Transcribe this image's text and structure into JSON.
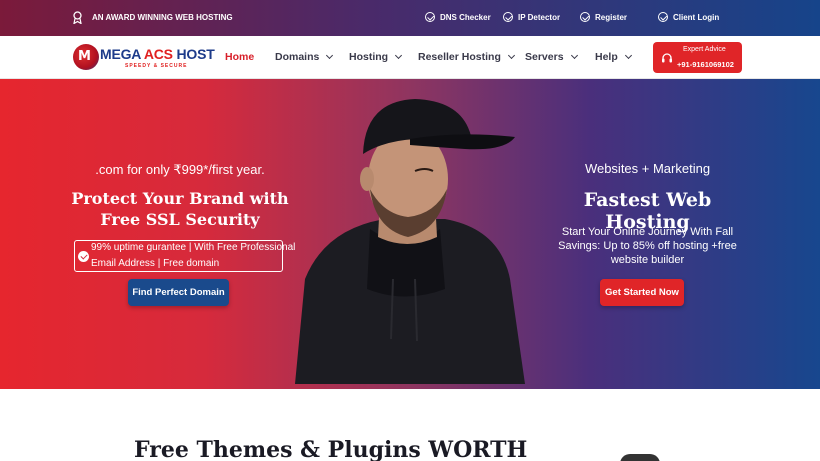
{
  "topbar": {
    "award_text": "AN AWARD WINNING WEB HOSTING",
    "links": {
      "dns": "DNS Checker",
      "ip": "IP Detector",
      "register": "Register",
      "client": "Client Login"
    }
  },
  "logo": {
    "name_part1": "MEGA ",
    "name_part2": "ACS",
    "name_part3": " HOST",
    "tagline": "SPEEDY & SECURE"
  },
  "nav": {
    "home": "Home",
    "domains": "Domains",
    "hosting": "Hosting",
    "reseller": "Reseller Hosting",
    "servers": "Servers",
    "help": "Help"
  },
  "expert": {
    "label": "Expert Advice",
    "phone": "+91-9161069102"
  },
  "hero_left": {
    "promo": ".com for only ₹999*/first year.",
    "headline_line1": "Protect Your Brand with",
    "headline_line2": "Free SSL Security",
    "feature_line1": "99% uptime gurantee | With Free Professional",
    "feature_line2": "Email Address | Free domain",
    "button": "Find Perfect Domain"
  },
  "hero_right": {
    "sub": "Websites + Marketing",
    "title": "Fastest Web Hosting",
    "desc_line1": "Start Your Online Journey With Fall",
    "desc_line2": "Savings: Up to 85% off hosting +free",
    "desc_line3": "website builder",
    "button": "Get Started Now"
  },
  "section": {
    "heading": "Free Themes & Plugins WORTH"
  },
  "colors": {
    "brand_red": "#e02528",
    "brand_blue": "#1a4a8c"
  }
}
